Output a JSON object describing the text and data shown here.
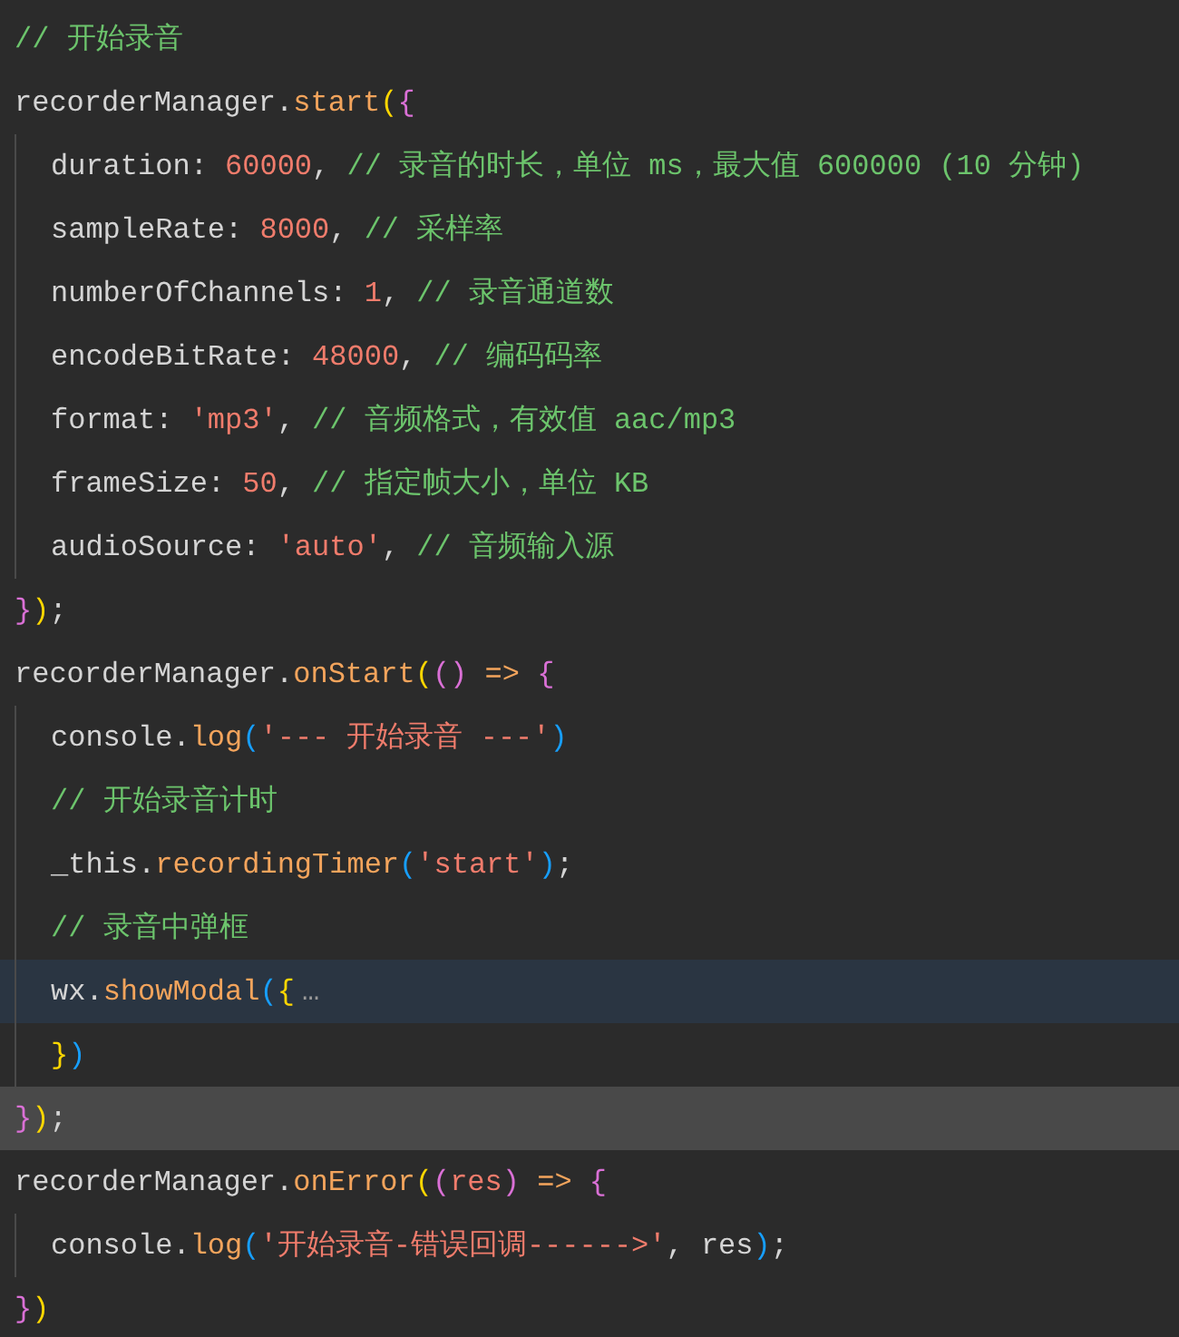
{
  "editor": {
    "lines": [
      {
        "selected": false,
        "hovered": false,
        "tokens": [
          {
            "kind": "comment",
            "text": "// 开始录音"
          }
        ]
      },
      {
        "selected": false,
        "hovered": false,
        "tokens": [
          {
            "kind": "plain",
            "text": "recorderManager."
          },
          {
            "kind": "method",
            "text": "start"
          },
          {
            "kind": "bracket1",
            "text": "("
          },
          {
            "kind": "bracket2",
            "text": "{"
          }
        ],
        "children": [
          {
            "selected": false,
            "hovered": false,
            "tokens": [
              {
                "kind": "plain",
                "text": "duration: "
              },
              {
                "kind": "number",
                "text": "60000"
              },
              {
                "kind": "plain",
                "text": ", "
              },
              {
                "kind": "comment",
                "text": "// 录音的时长，单位 ms，最大值 600000 (10 分钟)"
              }
            ]
          },
          {
            "selected": false,
            "hovered": false,
            "tokens": [
              {
                "kind": "plain",
                "text": "sampleRate: "
              },
              {
                "kind": "number",
                "text": "8000"
              },
              {
                "kind": "plain",
                "text": ", "
              },
              {
                "kind": "comment",
                "text": "// 采样率"
              }
            ]
          },
          {
            "selected": false,
            "hovered": false,
            "tokens": [
              {
                "kind": "plain",
                "text": "numberOfChannels: "
              },
              {
                "kind": "number",
                "text": "1"
              },
              {
                "kind": "plain",
                "text": ", "
              },
              {
                "kind": "comment",
                "text": "// 录音通道数"
              }
            ]
          },
          {
            "selected": false,
            "hovered": false,
            "tokens": [
              {
                "kind": "plain",
                "text": "encodeBitRate: "
              },
              {
                "kind": "number",
                "text": "48000"
              },
              {
                "kind": "plain",
                "text": ", "
              },
              {
                "kind": "comment",
                "text": "// 编码码率"
              }
            ]
          },
          {
            "selected": false,
            "hovered": false,
            "tokens": [
              {
                "kind": "plain",
                "text": "format: "
              },
              {
                "kind": "string",
                "text": "'mp3'"
              },
              {
                "kind": "plain",
                "text": ", "
              },
              {
                "kind": "comment",
                "text": "// 音频格式，有效值 aac/mp3"
              }
            ]
          },
          {
            "selected": false,
            "hovered": false,
            "tokens": [
              {
                "kind": "plain",
                "text": "frameSize: "
              },
              {
                "kind": "number",
                "text": "50"
              },
              {
                "kind": "plain",
                "text": ", "
              },
              {
                "kind": "comment",
                "text": "// 指定帧大小，单位 KB"
              }
            ]
          },
          {
            "selected": false,
            "hovered": false,
            "tokens": [
              {
                "kind": "plain",
                "text": "audioSource: "
              },
              {
                "kind": "string",
                "text": "'auto'"
              },
              {
                "kind": "plain",
                "text": ", "
              },
              {
                "kind": "comment",
                "text": "// 音频输入源"
              }
            ]
          }
        ]
      },
      {
        "selected": false,
        "hovered": false,
        "tokens": [
          {
            "kind": "bracket2",
            "text": "}"
          },
          {
            "kind": "bracket1",
            "text": ")"
          },
          {
            "kind": "plain",
            "text": ";"
          }
        ]
      },
      {
        "selected": false,
        "hovered": false,
        "tokens": [
          {
            "kind": "plain",
            "text": "recorderManager."
          },
          {
            "kind": "method",
            "text": "onStart"
          },
          {
            "kind": "bracket1",
            "text": "("
          },
          {
            "kind": "bracket2",
            "text": "()"
          },
          {
            "kind": "method",
            "text": " => "
          },
          {
            "kind": "bracket2",
            "text": "{"
          }
        ],
        "children": [
          {
            "selected": false,
            "hovered": false,
            "tokens": [
              {
                "kind": "plain",
                "text": "console."
              },
              {
                "kind": "method",
                "text": "log"
              },
              {
                "kind": "bracket3",
                "text": "("
              },
              {
                "kind": "string",
                "text": "'--- 开始录音 ---'"
              },
              {
                "kind": "bracket3",
                "text": ")"
              }
            ]
          },
          {
            "selected": false,
            "hovered": false,
            "tokens": [
              {
                "kind": "comment",
                "text": "// 开始录音计时"
              }
            ]
          },
          {
            "selected": false,
            "hovered": false,
            "tokens": [
              {
                "kind": "plain",
                "text": "_this."
              },
              {
                "kind": "method",
                "text": "recordingTimer"
              },
              {
                "kind": "bracket3",
                "text": "("
              },
              {
                "kind": "string",
                "text": "'start'"
              },
              {
                "kind": "bracket3",
                "text": ")"
              },
              {
                "kind": "plain",
                "text": ";"
              }
            ]
          },
          {
            "selected": false,
            "hovered": false,
            "tokens": [
              {
                "kind": "comment",
                "text": "// 录音中弹框"
              }
            ]
          },
          {
            "selected": false,
            "hovered": true,
            "tokens": [
              {
                "kind": "plain",
                "text": "wx."
              },
              {
                "kind": "method",
                "text": "showModal"
              },
              {
                "kind": "bracket3",
                "text": "("
              },
              {
                "kind": "bracket1",
                "text": "{"
              },
              {
                "kind": "fold",
                "text": "…"
              }
            ]
          },
          {
            "selected": false,
            "hovered": false,
            "tokens": [
              {
                "kind": "bracket1",
                "text": "}"
              },
              {
                "kind": "bracket3",
                "text": ")"
              }
            ]
          }
        ]
      },
      {
        "selected": true,
        "hovered": false,
        "tokens": [
          {
            "kind": "bracket2",
            "text": "}"
          },
          {
            "kind": "bracket1",
            "text": ")"
          },
          {
            "kind": "plain",
            "text": ";"
          }
        ]
      },
      {
        "selected": false,
        "hovered": false,
        "tokens": [
          {
            "kind": "plain",
            "text": "recorderManager."
          },
          {
            "kind": "method",
            "text": "onError"
          },
          {
            "kind": "bracket1",
            "text": "("
          },
          {
            "kind": "bracket2",
            "text": "("
          },
          {
            "kind": "string",
            "text": "res"
          },
          {
            "kind": "bracket2",
            "text": ")"
          },
          {
            "kind": "method",
            "text": " => "
          },
          {
            "kind": "bracket2",
            "text": "{"
          }
        ],
        "children": [
          {
            "selected": false,
            "hovered": false,
            "tokens": [
              {
                "kind": "plain",
                "text": "console."
              },
              {
                "kind": "method",
                "text": "log"
              },
              {
                "kind": "bracket3",
                "text": "("
              },
              {
                "kind": "string",
                "text": "'开始录音-错误回调------>'"
              },
              {
                "kind": "plain",
                "text": ", res"
              },
              {
                "kind": "bracket3",
                "text": ")"
              },
              {
                "kind": "plain",
                "text": ";"
              }
            ]
          }
        ]
      },
      {
        "selected": false,
        "hovered": false,
        "tokens": [
          {
            "kind": "bracket2",
            "text": "}"
          },
          {
            "kind": "bracket1",
            "text": ")"
          }
        ]
      }
    ]
  }
}
